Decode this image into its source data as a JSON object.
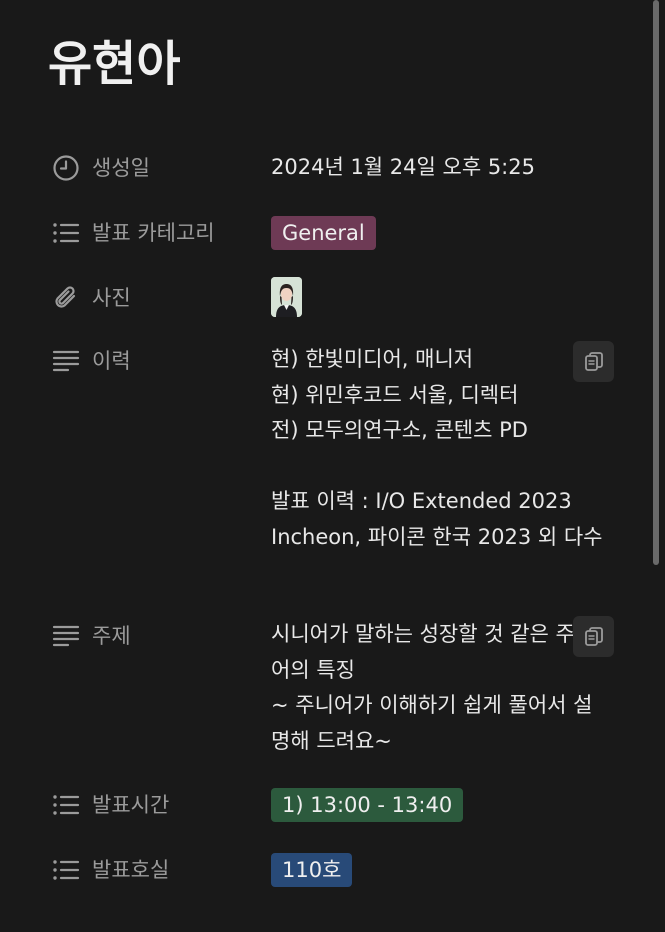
{
  "page": {
    "title": "유현아"
  },
  "properties": {
    "created": {
      "label": "생성일",
      "icon": "clock-icon",
      "value": "2024년 1월 24일 오후 5:25"
    },
    "category": {
      "label": "발표 카테고리",
      "icon": "list-icon",
      "tag": "General",
      "tag_color": "#6e3a55"
    },
    "photo": {
      "label": "사진",
      "icon": "paperclip-icon"
    },
    "history": {
      "label": "이력",
      "icon": "text-lines-icon",
      "value": "현) 한빛미디어, 매니저\n현) 위민후코드 서울, 디렉터\n전) 모두의연구소, 콘텐츠 PD\n\n발표 이력 : I/O Extended 2023 Incheon, 파이콘 한국 2023 외 다수"
    },
    "topic": {
      "label": "주제",
      "icon": "text-lines-icon",
      "value": "시니어가 말하는 성장할 것 같은 주니어의 특징\n~ 주니어가 이해하기 쉽게 풀어서 설명해 드려요~"
    },
    "time": {
      "label": "발표시간",
      "icon": "list-icon",
      "tag": "1) 13:00 - 13:40",
      "tag_color": "#2c5a3d"
    },
    "room": {
      "label": "발표호실",
      "icon": "list-icon",
      "tag": "110호",
      "tag_color": "#284a78"
    }
  }
}
